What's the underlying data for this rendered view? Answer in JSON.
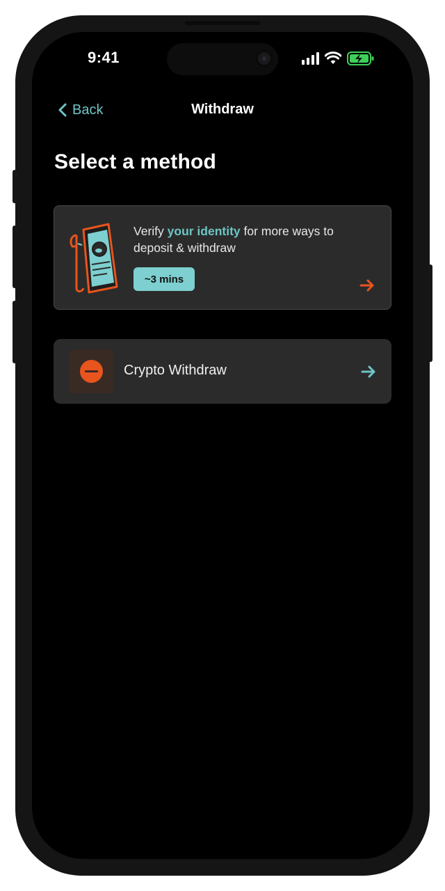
{
  "status_bar": {
    "time": "9:41",
    "icons": [
      "signal-icon",
      "wifi-icon",
      "battery-charging-icon"
    ]
  },
  "nav": {
    "back_label": "Back",
    "title": "Withdraw"
  },
  "page": {
    "heading": "Select a method"
  },
  "verify_card": {
    "text_prefix": "Verify ",
    "text_highlight": "your identity",
    "text_suffix": " for more ways to deposit & withdraw",
    "badge": "~3 mins",
    "icon": "document-illustration"
  },
  "methods": [
    {
      "label": "Crypto Withdraw",
      "icon": "crypto-coin-icon"
    }
  ],
  "colors": {
    "accent_teal": "#6ec6c6",
    "accent_orange": "#e8541e",
    "card_bg": "#2b2b2b",
    "battery_green": "#3ecf5a"
  }
}
